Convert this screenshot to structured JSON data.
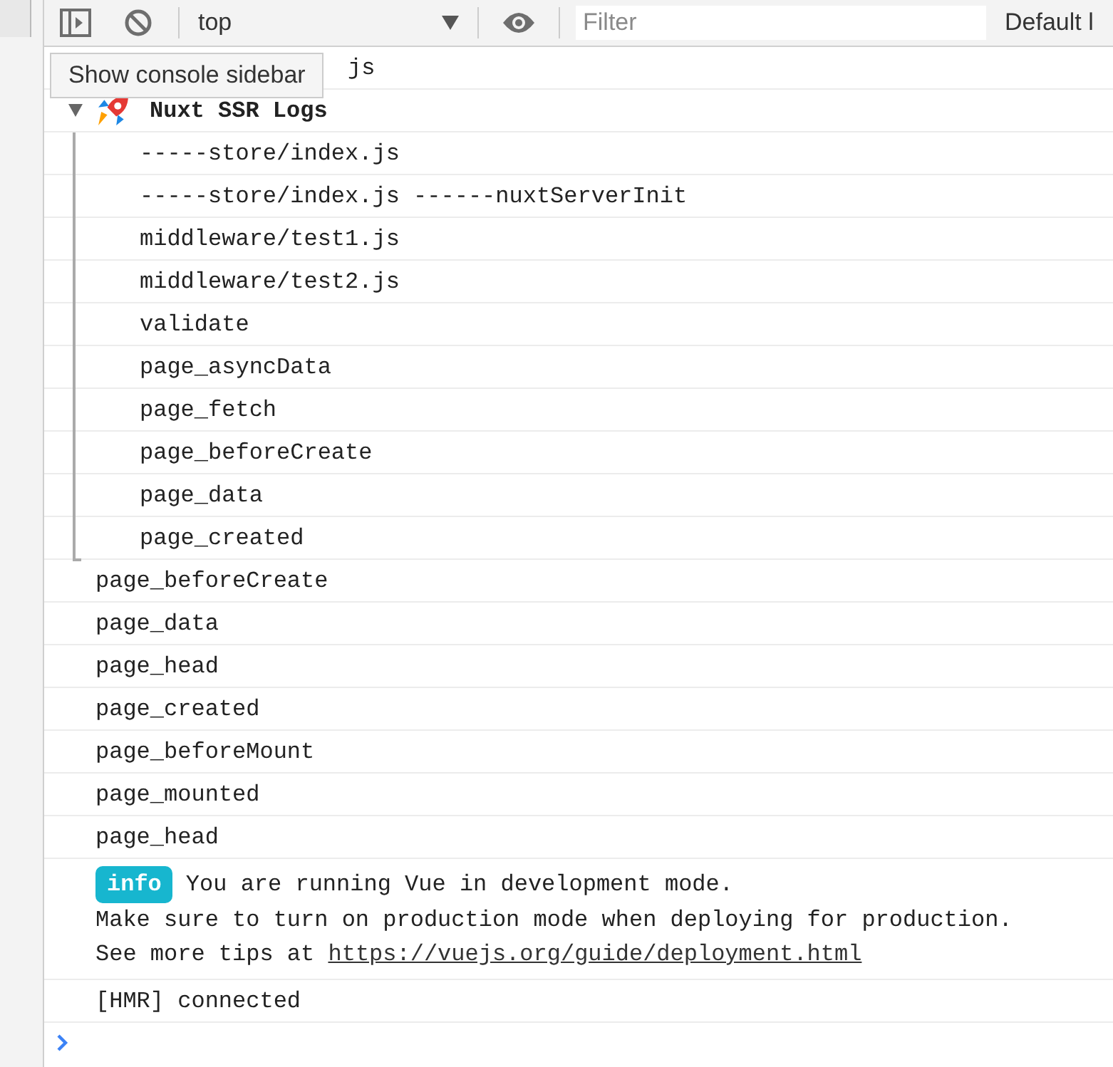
{
  "toolbar": {
    "context": "top",
    "filter_placeholder": "Filter",
    "levels": "Default l"
  },
  "tooltip": "Show console sidebar",
  "messages": [
    {
      "kind": "covered_log",
      "text": "js"
    },
    {
      "kind": "group",
      "title": "Nuxt SSR Logs",
      "expanded": true,
      "children": [
        {
          "kind": "log",
          "text": "-----store/index.js"
        },
        {
          "kind": "log",
          "text": "-----store/index.js ------nuxtServerInit"
        },
        {
          "kind": "log",
          "text": "middleware/test1.js"
        },
        {
          "kind": "log",
          "text": "middleware/test2.js"
        },
        {
          "kind": "log",
          "text": "validate"
        },
        {
          "kind": "log",
          "text": "page_asyncData"
        },
        {
          "kind": "log",
          "text": "page_fetch"
        },
        {
          "kind": "log",
          "text": "page_beforeCreate"
        },
        {
          "kind": "log",
          "text": "page_data"
        },
        {
          "kind": "log",
          "text": "page_created"
        }
      ]
    },
    {
      "kind": "log",
      "text": "page_beforeCreate"
    },
    {
      "kind": "log",
      "text": "page_data"
    },
    {
      "kind": "log",
      "text": "page_head"
    },
    {
      "kind": "log",
      "text": "page_created"
    },
    {
      "kind": "log",
      "text": "page_beforeMount"
    },
    {
      "kind": "log",
      "text": "page_mounted"
    },
    {
      "kind": "log",
      "text": "page_head"
    },
    {
      "kind": "info",
      "badge": "info",
      "lines": [
        "You are running Vue in development mode.",
        "Make sure to turn on production mode when deploying for production."
      ],
      "link_prefix": "See more tips at ",
      "link": "https://vuejs.org/guide/deployment.html"
    },
    {
      "kind": "log",
      "text": "[HMR] connected"
    }
  ]
}
